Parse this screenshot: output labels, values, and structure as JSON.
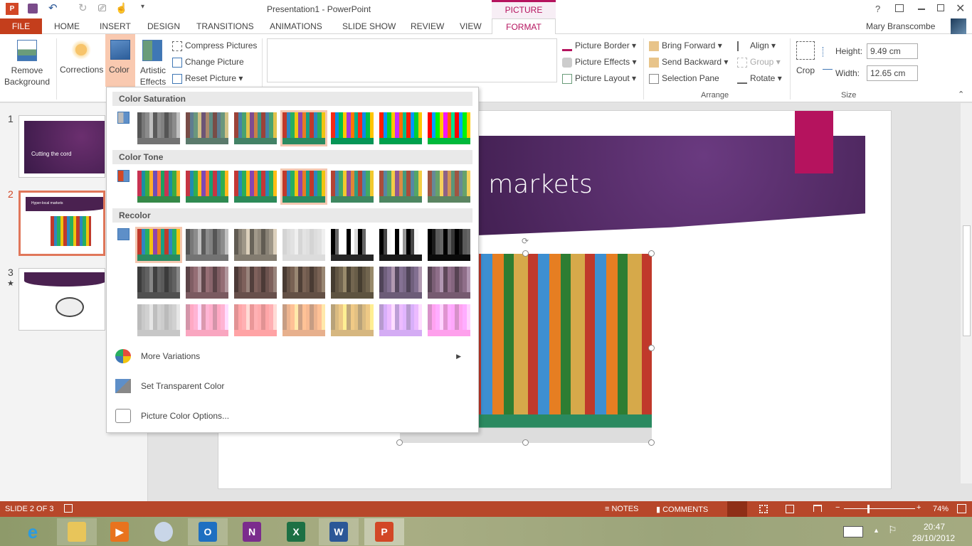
{
  "window": {
    "title": "Presentation1 - PowerPoint",
    "context_tab_group": "PICTURE TOOLS",
    "user": "Mary Branscombe",
    "help": "?",
    "controls": [
      "minimize",
      "restore",
      "close"
    ]
  },
  "tabs": [
    "FILE",
    "HOME",
    "INSERT",
    "DESIGN",
    "TRANSITIONS",
    "ANIMATIONS",
    "SLIDE SHOW",
    "REVIEW",
    "VIEW",
    "FORMAT"
  ],
  "active_tab": "FORMAT",
  "ribbon": {
    "remove_background": "Remove Background",
    "corrections": "Corrections",
    "color": "Color",
    "artistic_effects": "Artistic Effects",
    "compress": "Compress Pictures",
    "change": "Change Picture",
    "reset": "Reset Picture",
    "picture_border": "Picture Border",
    "picture_effects": "Picture Effects",
    "picture_layout": "Picture Layout",
    "bring_forward": "Bring Forward",
    "send_backward": "Send Backward",
    "selection_pane": "Selection Pane",
    "align": "Align",
    "group": "Group",
    "rotate": "Rotate",
    "arrange_label": "Arrange",
    "crop": "Crop",
    "height_label": "Height:",
    "height_value": "9.49 cm",
    "width_label": "Width:",
    "width_value": "12.65 cm",
    "size_label": "Size"
  },
  "color_menu": {
    "sections": [
      "Color Saturation",
      "Color Tone",
      "Recolor"
    ],
    "selected": {
      "saturation": 3,
      "tone": 3,
      "recolor": 0
    },
    "more_variations": "More Variations",
    "set_transparent": "Set Transparent Color",
    "options": "Picture Color Options..."
  },
  "slides": [
    {
      "number": "1",
      "title": "Cutting the cord"
    },
    {
      "number": "2",
      "title": "Hyper-local markets"
    },
    {
      "number": "3",
      "title": ""
    }
  ],
  "current_slide_title": "Hyper-local markets",
  "status": {
    "slide": "SLIDE 2 OF 3",
    "notes": "NOTES",
    "comments": "COMMENTS",
    "zoom": "74%",
    "zoom_level": 74
  },
  "taskbar": {
    "apps": [
      "Internet Explorer",
      "File Explorer",
      "Video",
      "Paint",
      "Outlook",
      "OneNote",
      "Excel",
      "Word",
      "PowerPoint"
    ],
    "time": "20:47",
    "date": "28/10/2012"
  },
  "colors": {
    "accent": "#b7472a",
    "file_tab": "#c43e1c",
    "purple": "#4a2150",
    "pink": "#b5135e",
    "selection": "#f4c7b0"
  }
}
